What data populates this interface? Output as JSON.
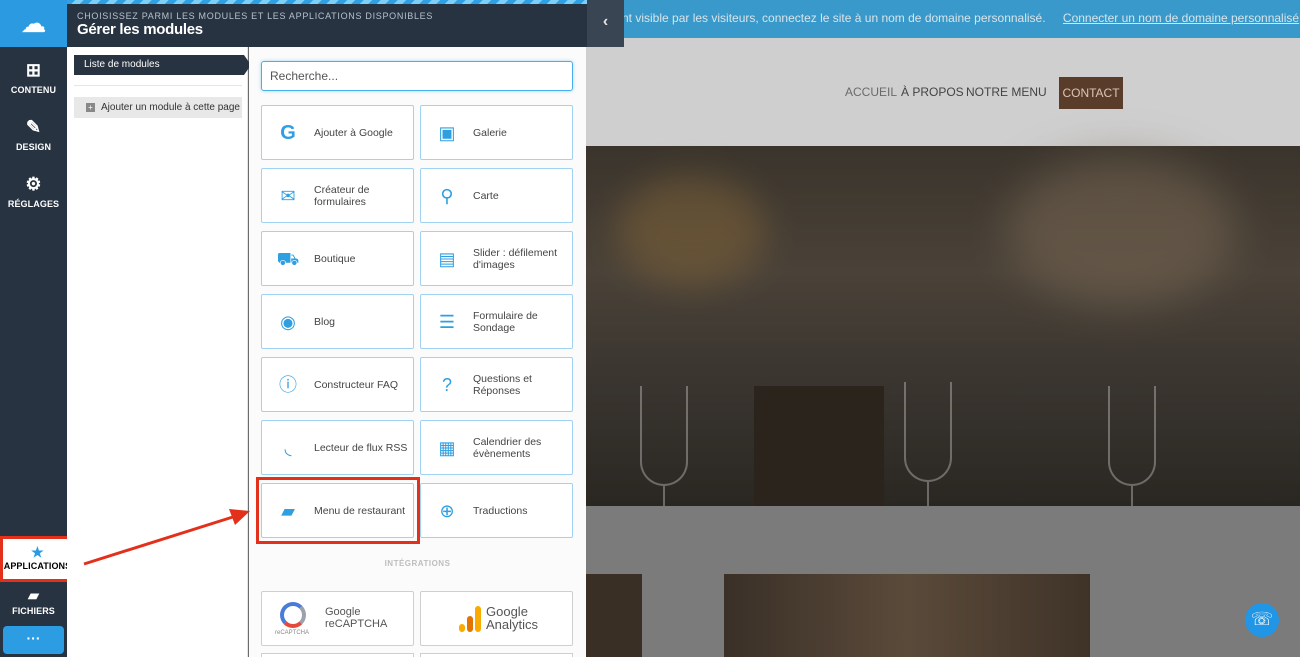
{
  "site": {
    "notice_text": "nt visible par les visiteurs, connectez le site à un nom de domaine personnalisé.",
    "notice_link": "Connecter un nom de domaine personnalisé",
    "nav": [
      "ACCUEIL",
      "À PROPOS",
      "NOTRE MENU",
      "CONTACT"
    ],
    "support_icon": "headset-icon"
  },
  "rail": {
    "logo_icon": "cloud-icon",
    "items": [
      {
        "label": "CONTENU",
        "icon": "plus-square-icon"
      },
      {
        "label": "DESIGN",
        "icon": "brush-icon"
      },
      {
        "label": "RÉGLAGES",
        "icon": "gears-icon"
      },
      {
        "label": "APPLICATIONS",
        "icon": "star-icon"
      },
      {
        "label": "FICHIERS",
        "icon": "folder-icon"
      }
    ],
    "more_label": "···"
  },
  "panel": {
    "subtitle": "CHOISISSEZ PARMI LES MODULES ET LES APPLICATIONS DISPONIBLES",
    "title": "Gérer les modules",
    "collapse_icon": "chevron-left-icon",
    "subnav": {
      "active": "Liste de modules",
      "add": "Ajouter un module à cette page"
    },
    "search_placeholder": "Recherche...",
    "modules": [
      {
        "label": "Ajouter à Google",
        "icon": "google-icon"
      },
      {
        "label": "Galerie",
        "icon": "gallery-icon"
      },
      {
        "label": "Créateur de formulaires",
        "icon": "envelope-icon"
      },
      {
        "label": "Carte",
        "icon": "map-pin-icon"
      },
      {
        "label": "Boutique",
        "icon": "cart-icon"
      },
      {
        "label": "Slider : défilement d'images",
        "icon": "slider-icon"
      },
      {
        "label": "Blog",
        "icon": "podcast-icon"
      },
      {
        "label": "Formulaire de Sondage",
        "icon": "checklist-icon"
      },
      {
        "label": "Constructeur FAQ",
        "icon": "info-icon"
      },
      {
        "label": "Questions et Réponses",
        "icon": "question-icon"
      },
      {
        "label": "Lecteur de flux RSS",
        "icon": "rss-icon"
      },
      {
        "label": "Calendrier des évènements",
        "icon": "calendar-icon"
      },
      {
        "label": "Menu de restaurant",
        "icon": "folder-open-icon"
      },
      {
        "label": "Traductions",
        "icon": "globe-icon"
      }
    ],
    "integrations_heading": "INTÉGRATIONS",
    "integrations": [
      {
        "label": "Google reCAPTCHA",
        "small": "reCAPTCHA",
        "icon": "recaptcha-icon"
      },
      {
        "label": "Google Analytics",
        "icon": "google-analytics-icon"
      }
    ]
  },
  "annotation_color": "#e3301b",
  "accent_color": "#2e9fe0"
}
